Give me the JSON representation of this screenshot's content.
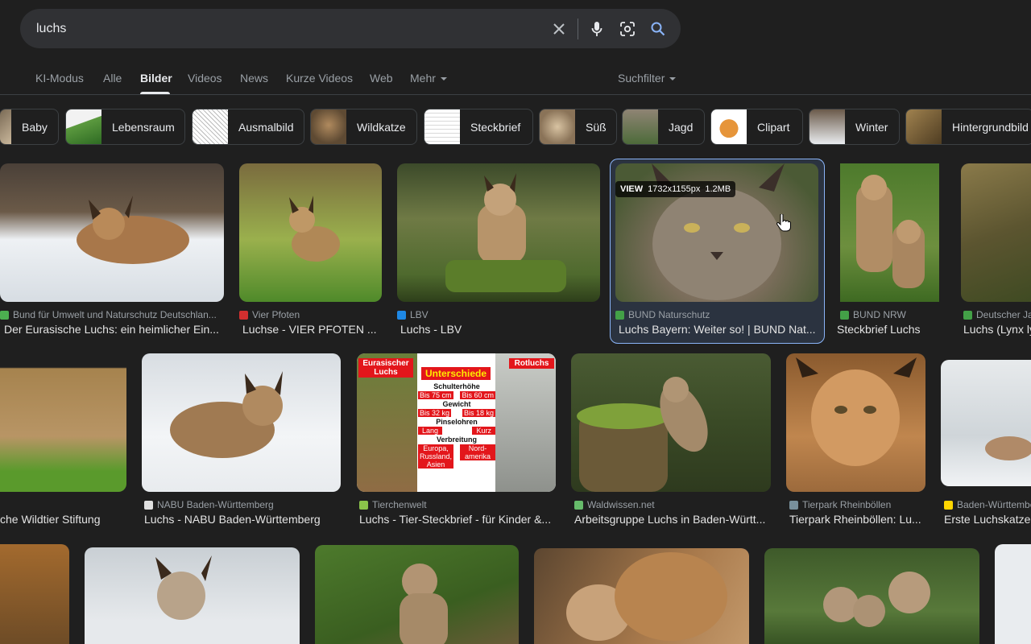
{
  "search": {
    "query": "luchs",
    "placeholder": "",
    "icons": [
      "clear-icon",
      "mic-icon",
      "lens-icon",
      "search-icon"
    ]
  },
  "tabs": [
    {
      "label": "KI-Modus"
    },
    {
      "label": "Alle"
    },
    {
      "label": "Bilder",
      "active": true
    },
    {
      "label": "Videos"
    },
    {
      "label": "News"
    },
    {
      "label": "Kurze Videos"
    },
    {
      "label": "Web"
    },
    {
      "label": "Mehr"
    }
  ],
  "filter": {
    "label": "Suchfilter"
  },
  "chips": [
    {
      "label": "Baby"
    },
    {
      "label": "Lebensraum"
    },
    {
      "label": "Ausmalbild"
    },
    {
      "label": "Wildkatze"
    },
    {
      "label": "Steckbrief"
    },
    {
      "label": "Süß"
    },
    {
      "label": "Jagd"
    },
    {
      "label": "Clipart"
    },
    {
      "label": "Winter"
    },
    {
      "label": "Hintergrundbild"
    }
  ],
  "results": [
    {
      "source": "Bund für Umwelt und Naturschutz Deutschlan...",
      "title": "Der Eurasische Luchs: ein heimlicher Ein..."
    },
    {
      "source": "Vier Pfoten",
      "title": "Luchse - VIER PFOTEN ..."
    },
    {
      "source": "LBV",
      "title": "Luchs - LBV"
    },
    {
      "source": "BUND Naturschutz",
      "title": "Luchs Bayern: Weiter so! | BUND Nat...",
      "selected": true
    },
    {
      "source": "BUND NRW",
      "title": "Steckbrief Luchs"
    },
    {
      "source": "Deutscher Ja",
      "title": "Luchs (Lynx ly"
    },
    {
      "source": "",
      "title": "che Wildtier Stiftung"
    },
    {
      "source": "NABU Baden-Württemberg",
      "title": "Luchs - NABU Baden-Württemberg"
    },
    {
      "source": "Tierchenwelt",
      "title": "Luchs - Tier-Steckbrief - für Kinder &..."
    },
    {
      "source": "Waldwissen.net",
      "title": "Arbeitsgruppe Luchs in Baden-Württ..."
    },
    {
      "source": "Tierpark Rheinböllen",
      "title": "Tierpark Rheinböllen: Lu..."
    },
    {
      "source": "Baden-Württembe",
      "title": "Erste Luchskatze"
    }
  ],
  "view_badge": {
    "label": "VIEW",
    "dims": "1732x1155px",
    "size": "1.2MB"
  },
  "infographic": {
    "left": "Eurasischer Luchs",
    "center": "Unterschiede",
    "right": "Rotluchs",
    "rows": [
      {
        "head": "Schulterhöhe",
        "a": "Bis 75 cm",
        "b": "Bis 60 cm"
      },
      {
        "head": "Gewicht",
        "a": "Bis 32 kg",
        "b": "Bis 18 kg"
      },
      {
        "head": "Pinselohren",
        "a": "Lang",
        "b": "Kurz"
      },
      {
        "head": "Verbreitung",
        "a": "Europa, Russland, Asien",
        "b": "Nord-amerika"
      }
    ]
  }
}
